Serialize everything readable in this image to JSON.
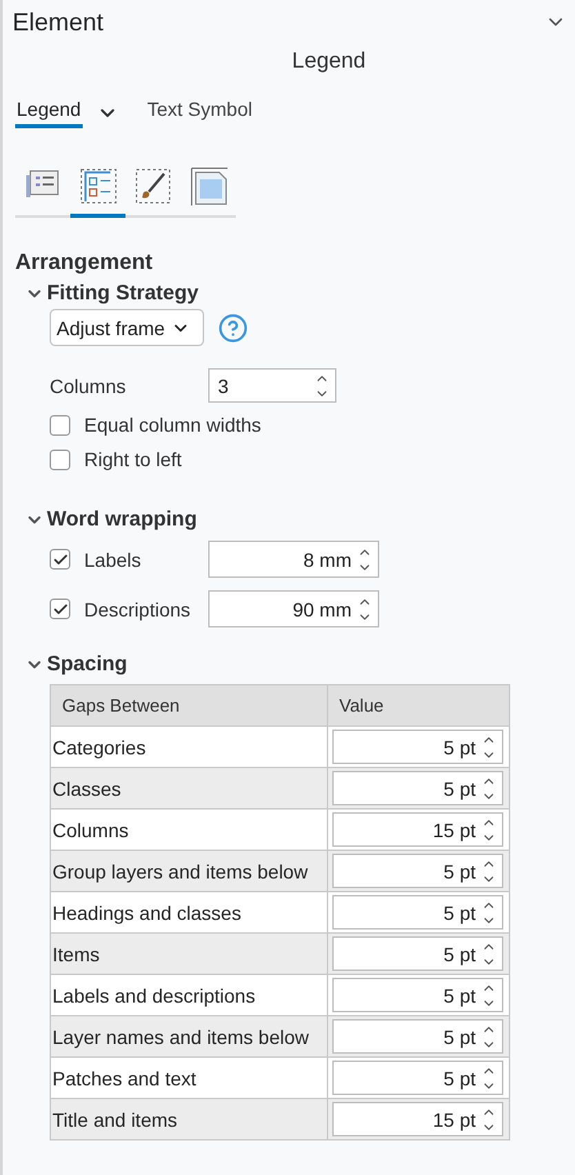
{
  "pane": {
    "title": "Element",
    "subtitle": "Legend"
  },
  "tabs": [
    {
      "label": "Legend",
      "selected": true,
      "dropdown": true
    },
    {
      "label": "Text Symbol",
      "selected": false,
      "dropdown": false
    }
  ],
  "icon_tabs": [
    {
      "kind": "items",
      "selected": false
    },
    {
      "kind": "arrangement",
      "selected": true
    },
    {
      "kind": "display",
      "selected": false
    },
    {
      "kind": "placement",
      "selected": false
    }
  ],
  "section": {
    "title": "Arrangement"
  },
  "fitting_strategy": {
    "title": "Fitting Strategy",
    "expanded": true,
    "dropdown_value": "Adjust frame",
    "columns_label": "Columns",
    "columns_value": "3",
    "options": [
      {
        "label": "Equal column widths",
        "checked": false
      },
      {
        "label": "Right to left",
        "checked": false
      }
    ]
  },
  "word_wrapping": {
    "title": "Word wrapping",
    "expanded": true,
    "rows": [
      {
        "label": "Labels",
        "checked": true,
        "value": "8 mm"
      },
      {
        "label": "Descriptions",
        "checked": true,
        "value": "90 mm"
      }
    ]
  },
  "spacing": {
    "title": "Spacing",
    "expanded": true,
    "table": {
      "columns": [
        "Gaps Between",
        "Value"
      ],
      "rows": [
        {
          "name": "Categories",
          "value": "5 pt"
        },
        {
          "name": "Classes",
          "value": "5 pt"
        },
        {
          "name": "Columns",
          "value": "15 pt"
        },
        {
          "name": "Group layers and items below",
          "value": "5 pt"
        },
        {
          "name": "Headings and classes",
          "value": "5 pt"
        },
        {
          "name": "Items",
          "value": "5 pt"
        },
        {
          "name": "Labels and descriptions",
          "value": "5 pt"
        },
        {
          "name": "Layer names and items below",
          "value": "5 pt"
        },
        {
          "name": "Patches and text",
          "value": "5 pt"
        },
        {
          "name": "Title and items",
          "value": "15 pt"
        }
      ]
    }
  }
}
